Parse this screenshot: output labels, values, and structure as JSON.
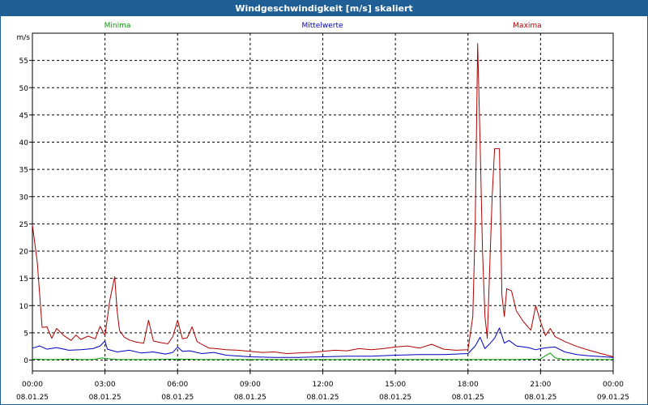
{
  "window": {
    "title": "Windgeschwindigkeit [m/s] skaliert"
  },
  "chart_data": {
    "type": "line",
    "title": "Windgeschwindigkeit [m/s] skaliert",
    "ylabel": "m/s",
    "ylim": [
      -2,
      60
    ],
    "yticks": [
      0,
      5,
      10,
      15,
      20,
      25,
      30,
      35,
      40,
      45,
      50,
      55
    ],
    "xlim": [
      0,
      24
    ],
    "xticks": [
      {
        "x": 0,
        "time": "00:00",
        "date": "08.01.25"
      },
      {
        "x": 3,
        "time": "03:00",
        "date": "08.01.25"
      },
      {
        "x": 6,
        "time": "06:00",
        "date": "08.01.25"
      },
      {
        "x": 9,
        "time": "09:00",
        "date": "08.01.25"
      },
      {
        "x": 12,
        "time": "12:00",
        "date": "08.01.25"
      },
      {
        "x": 15,
        "time": "15:00",
        "date": "08.01.25"
      },
      {
        "x": 18,
        "time": "18:00",
        "date": "08.01.25"
      },
      {
        "x": 21,
        "time": "21:00",
        "date": "08.01.25"
      },
      {
        "x": 24,
        "time": "00:00",
        "date": "09.01.25"
      }
    ],
    "grid": true,
    "legend_position": "top",
    "series": [
      {
        "name": "Minima",
        "color": "#00a000",
        "points": [
          [
            0,
            0.2
          ],
          [
            0.5,
            0.1
          ],
          [
            1,
            0.1
          ],
          [
            1.5,
            0.2
          ],
          [
            2,
            0.1
          ],
          [
            2.5,
            0.1
          ],
          [
            2.9,
            0.4
          ],
          [
            3,
            0.3
          ],
          [
            3.5,
            0.1
          ],
          [
            4,
            0.1
          ],
          [
            5,
            0.1
          ],
          [
            6,
            0.2
          ],
          [
            7,
            0.1
          ],
          [
            8,
            0.1
          ],
          [
            9,
            0.1
          ],
          [
            12,
            0.1
          ],
          [
            15,
            0.1
          ],
          [
            18,
            0.1
          ],
          [
            20,
            0.1
          ],
          [
            21,
            0.2
          ],
          [
            21.2,
            0.8
          ],
          [
            21.4,
            1.3
          ],
          [
            21.6,
            0.4
          ],
          [
            22,
            0.1
          ],
          [
            24,
            0.1
          ]
        ]
      },
      {
        "name": "Mittelwerte",
        "color": "#0000c0",
        "points": [
          [
            0,
            2.2
          ],
          [
            0.3,
            2.6
          ],
          [
            0.6,
            2.0
          ],
          [
            1,
            2.3
          ],
          [
            1.5,
            1.8
          ],
          [
            2,
            1.9
          ],
          [
            2.5,
            2.1
          ],
          [
            2.8,
            2.6
          ],
          [
            3,
            3.5
          ],
          [
            3.1,
            2.0
          ],
          [
            3.5,
            1.5
          ],
          [
            4,
            1.8
          ],
          [
            4.5,
            1.3
          ],
          [
            5,
            1.5
          ],
          [
            5.5,
            1.1
          ],
          [
            5.8,
            1.4
          ],
          [
            6,
            2.4
          ],
          [
            6.2,
            1.6
          ],
          [
            6.5,
            1.7
          ],
          [
            7,
            1.2
          ],
          [
            7.5,
            1.4
          ],
          [
            8,
            0.9
          ],
          [
            9,
            0.6
          ],
          [
            10,
            0.5
          ],
          [
            11,
            0.5
          ],
          [
            12,
            0.6
          ],
          [
            13,
            0.7
          ],
          [
            14,
            0.7
          ],
          [
            15,
            0.9
          ],
          [
            16,
            1.0
          ],
          [
            17,
            1.0
          ],
          [
            18,
            1.2
          ],
          [
            18.3,
            2.6
          ],
          [
            18.5,
            4.2
          ],
          [
            18.7,
            2.1
          ],
          [
            18.9,
            3.0
          ],
          [
            19.1,
            4.0
          ],
          [
            19.3,
            5.9
          ],
          [
            19.5,
            3.1
          ],
          [
            19.7,
            3.6
          ],
          [
            20,
            2.6
          ],
          [
            20.5,
            2.3
          ],
          [
            20.8,
            1.9
          ],
          [
            21,
            2.1
          ],
          [
            21.3,
            2.3
          ],
          [
            21.6,
            2.4
          ],
          [
            22,
            1.5
          ],
          [
            22.5,
            1.0
          ],
          [
            23,
            0.8
          ],
          [
            24,
            0.5
          ]
        ]
      },
      {
        "name": "Maxima",
        "color": "#b00000",
        "points": [
          [
            0,
            24.8
          ],
          [
            0.2,
            18
          ],
          [
            0.4,
            6
          ],
          [
            0.6,
            6.1
          ],
          [
            0.8,
            4
          ],
          [
            1,
            5.8
          ],
          [
            1.3,
            4.5
          ],
          [
            1.6,
            3.6
          ],
          [
            1.8,
            4.6
          ],
          [
            2,
            3.8
          ],
          [
            2.3,
            4.4
          ],
          [
            2.6,
            3.9
          ],
          [
            2.8,
            6.2
          ],
          [
            3,
            4.5
          ],
          [
            3.2,
            11
          ],
          [
            3.4,
            15.3
          ],
          [
            3.5,
            9
          ],
          [
            3.6,
            5.4
          ],
          [
            3.8,
            4.2
          ],
          [
            4,
            3.7
          ],
          [
            4.3,
            3.3
          ],
          [
            4.6,
            3.1
          ],
          [
            4.8,
            7.3
          ],
          [
            5,
            3.5
          ],
          [
            5.3,
            3.2
          ],
          [
            5.6,
            3.0
          ],
          [
            5.8,
            4.3
          ],
          [
            6,
            7.3
          ],
          [
            6.2,
            3.9
          ],
          [
            6.4,
            4.1
          ],
          [
            6.6,
            6.1
          ],
          [
            6.8,
            3.4
          ],
          [
            7,
            2.9
          ],
          [
            7.3,
            2.2
          ],
          [
            7.6,
            2.1
          ],
          [
            8,
            1.9
          ],
          [
            8.5,
            1.8
          ],
          [
            9,
            1.6
          ],
          [
            9.5,
            1.4
          ],
          [
            10,
            1.5
          ],
          [
            10.5,
            1.2
          ],
          [
            11,
            1.3
          ],
          [
            11.5,
            1.4
          ],
          [
            12,
            1.6
          ],
          [
            12.5,
            1.8
          ],
          [
            13,
            1.7
          ],
          [
            13.5,
            2.1
          ],
          [
            14,
            1.9
          ],
          [
            14.5,
            2.1
          ],
          [
            15,
            2.4
          ],
          [
            15.5,
            2.6
          ],
          [
            16,
            2.2
          ],
          [
            16.5,
            2.9
          ],
          [
            17,
            2.0
          ],
          [
            17.5,
            1.8
          ],
          [
            18,
            1.9
          ],
          [
            18.2,
            8
          ],
          [
            18.3,
            25
          ],
          [
            18.4,
            58.1
          ],
          [
            18.5,
            40
          ],
          [
            18.6,
            20
          ],
          [
            18.7,
            8
          ],
          [
            18.8,
            4
          ],
          [
            19,
            30
          ],
          [
            19.1,
            38.8
          ],
          [
            19.2,
            38.8
          ],
          [
            19.3,
            38.8
          ],
          [
            19.4,
            12
          ],
          [
            19.5,
            8
          ],
          [
            19.6,
            13.1
          ],
          [
            19.8,
            12.7
          ],
          [
            20,
            9
          ],
          [
            20.3,
            7
          ],
          [
            20.6,
            5.5
          ],
          [
            20.8,
            10
          ],
          [
            21,
            7
          ],
          [
            21.2,
            4.5
          ],
          [
            21.4,
            5.8
          ],
          [
            21.6,
            4.3
          ],
          [
            22,
            3.4
          ],
          [
            22.5,
            2.5
          ],
          [
            23,
            1.8
          ],
          [
            23.5,
            1.2
          ],
          [
            24,
            0.6
          ]
        ]
      }
    ]
  }
}
